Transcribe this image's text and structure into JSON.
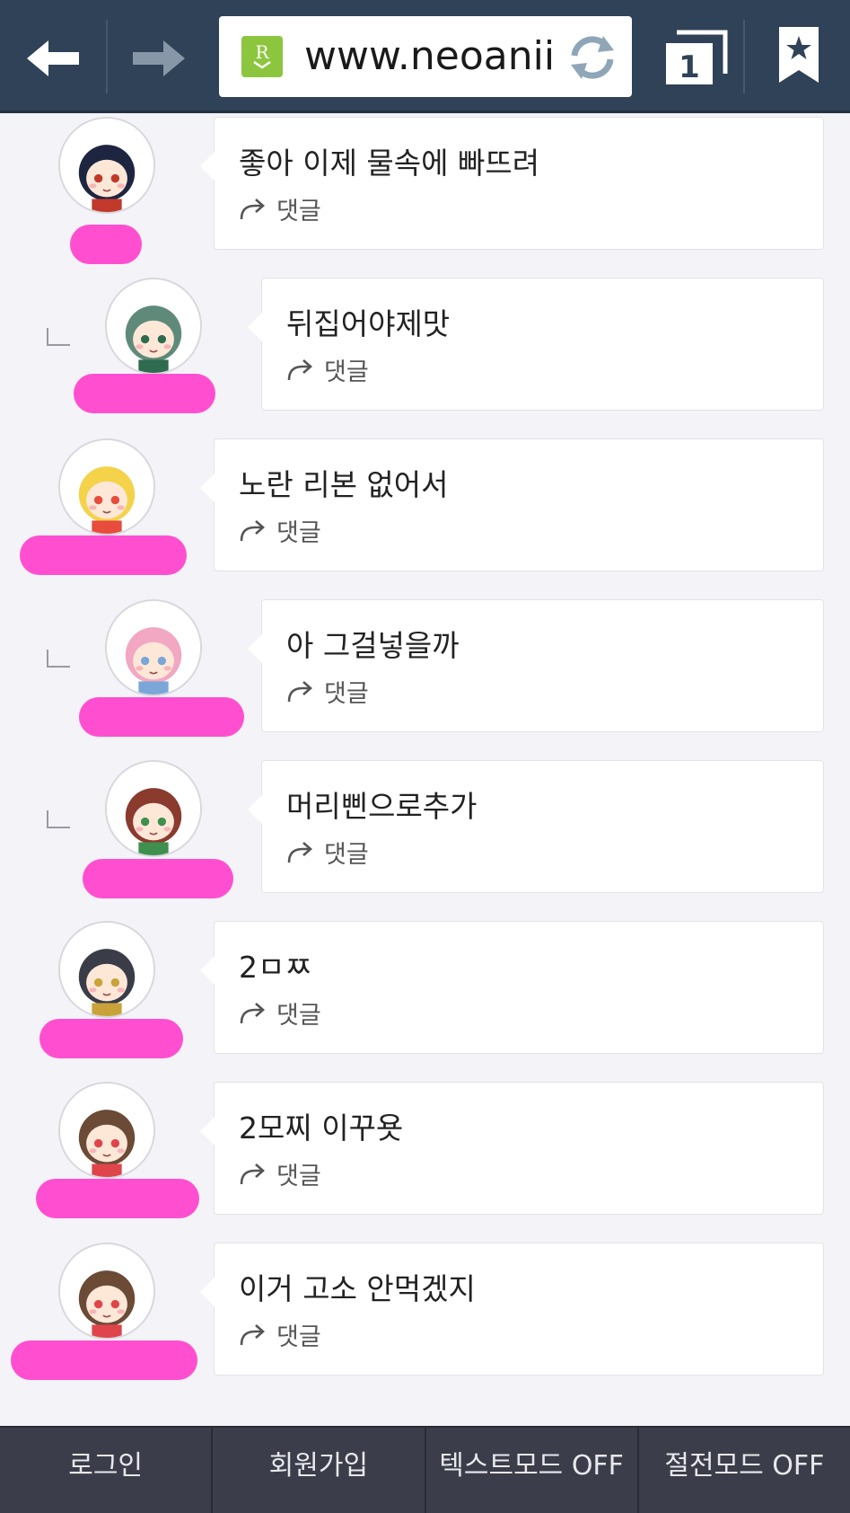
{
  "browser": {
    "url_display": "www.neoanii",
    "tab_count": "1",
    "icons": [
      "back-arrow-icon",
      "forward-arrow-icon",
      "rss-icon",
      "refresh-icon",
      "tabs-icon",
      "bookmark-star-icon"
    ]
  },
  "comments": [
    {
      "text": "좋아 이제 물속에 빠뜨려",
      "reply_label": "댓글",
      "is_reply": false,
      "hair": "#1e2540",
      "accent": "#c0392b"
    },
    {
      "text": "뒤집어야제맛",
      "reply_label": "댓글",
      "is_reply": true,
      "hair": "#5f8a7a",
      "accent": "#2e6b4f"
    },
    {
      "text": "노란 리본 없어서",
      "reply_label": "댓글",
      "is_reply": false,
      "hair": "#f4d34a",
      "accent": "#e74c3c"
    },
    {
      "text": "아 그걸넣을까",
      "reply_label": "댓글",
      "is_reply": true,
      "hair": "#f2a7c3",
      "accent": "#7aa7d8"
    },
    {
      "text": "머리삔으로추가",
      "reply_label": "댓글",
      "is_reply": true,
      "hair": "#8a3b2e",
      "accent": "#3f8f4f"
    },
    {
      "text": "2ㅁㅉ",
      "reply_label": "댓글",
      "is_reply": false,
      "hair": "#3a3c48",
      "accent": "#c9a23a"
    },
    {
      "text": "2모찌 이꾸욧",
      "reply_label": "댓글",
      "is_reply": false,
      "hair": "#6b4a36",
      "accent": "#e0444b"
    },
    {
      "text": "이거 고소 안먹겠지",
      "reply_label": "댓글",
      "is_reply": false,
      "hair": "#6b4a36",
      "accent": "#e0444b"
    }
  ],
  "bottom_bar": {
    "login": "로그인",
    "signup": "회원가입",
    "text_mode": "텍스트모드 OFF",
    "power_save": "절전모드 OFF"
  },
  "colors": {
    "topbar": "#2f4257",
    "bottombar": "#3b3d4a",
    "name_redaction": "#ff4fd0",
    "rss_green": "#8cc63f",
    "background": "#f4f3f8"
  }
}
